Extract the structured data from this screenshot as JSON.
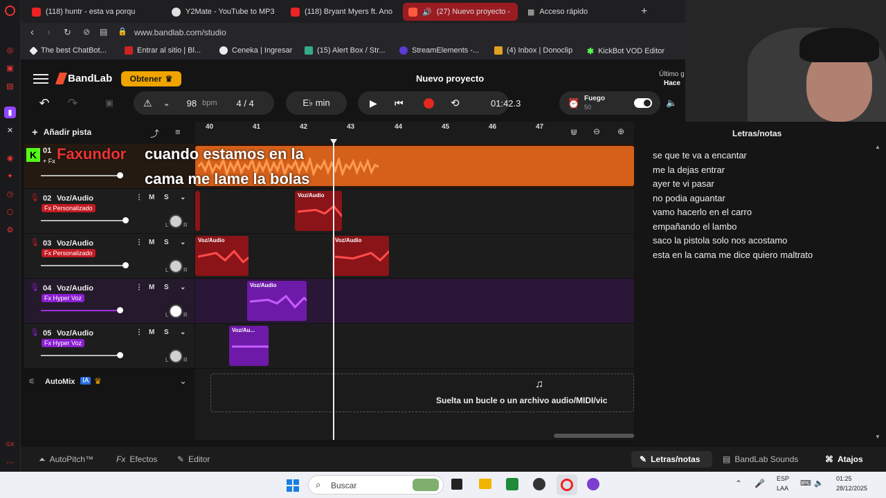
{
  "browser": {
    "tabs": [
      {
        "label": "(118) huntr - esta va porqu",
        "active": false
      },
      {
        "label": "Y2Mate - YouTube to MP3",
        "active": false
      },
      {
        "label": "(118) Bryant Myers ft. Ano",
        "active": false
      },
      {
        "label": "(27) Nuevo proyecto -",
        "active": true
      },
      {
        "label": "Acceso rápido",
        "active": false
      }
    ],
    "url": "www.bandlab.com/studio",
    "bookmarks": [
      "The best ChatBot...",
      "Entrar al sitio | Bl...",
      "Ceneka | Ingresar",
      "(15) Alert Box / Str...",
      "StreamElements -...",
      "(4) Inbox | Donoclip",
      "KickBot VOD Editor"
    ]
  },
  "app": {
    "brand": "BandLab",
    "get_button": "Obtener",
    "project_title": "Nuevo proyecto",
    "save_status": "Último g",
    "save_status2": "Hace",
    "bpm_value": "98",
    "bpm_unit": "bpm",
    "time_signature": "4 / 4",
    "key": "E♭ min",
    "time_display": "01:42.3",
    "fuego_label": "Fuego",
    "fuego_value": "50",
    "add_track": "Añadir pista",
    "ruler": [
      "40",
      "41",
      "42",
      "43",
      "44",
      "45",
      "46",
      "47"
    ],
    "overlay_name": "Faxundor",
    "overlay_text_line1": "cuando estamos en la",
    "overlay_text_line2": "cama me lame la bolas",
    "tracks": [
      {
        "num": "01",
        "name": "",
        "fx": "+ Fx"
      },
      {
        "num": "02",
        "name": "Voz/Audio",
        "fx": "Fx Personalizado"
      },
      {
        "num": "03",
        "name": "Voz/Audio",
        "fx": "Fx Personalizado"
      },
      {
        "num": "04",
        "name": "Voz/Audio",
        "fx": "Fx Hyper Voz"
      },
      {
        "num": "05",
        "name": "Voz/Audio",
        "fx": "Fx Hyper Voz"
      }
    ],
    "clip_labels": [
      "Voz/Audio",
      "Voz/Audio",
      "Voz/Audio",
      "Voz/Audio",
      "Voz/Au..."
    ],
    "mute": "M",
    "solo": "S",
    "pan_l": "L",
    "pan_r": "R",
    "automix": "AutoMix",
    "automix_badge": "IA",
    "drop_hint": "Suelta un bucle o un archivo audio/MIDI/vic",
    "notes_title": "Letras/notas",
    "lyrics": [
      "se que te va a encantar",
      "me la dejas  entrar",
      "ayer te vi pasar",
      "no podia aguantar",
      "vamo hacerlo en el carro",
      "empañando el lambo",
      "saco la pistola solo nos acostamo",
      "esta en la  cama me dice quiero maltrato"
    ],
    "bottom": {
      "autopitch": "AutoPitch™",
      "effects": "Efectos",
      "editor": "Editor",
      "notes_tab": "Letras/notas",
      "sounds": "BandLab Sounds",
      "shortcuts": "Atajos"
    }
  },
  "taskbar": {
    "search": "Buscar",
    "lang1": "ESP",
    "lang2": "LAA",
    "time": "01:25",
    "date": "28/12/2025"
  },
  "colors": {
    "accent": "#f0a400",
    "orange": "#f06a1a",
    "red": "#c41a22",
    "purple": "#8a1fd1",
    "record": "#e3281e"
  }
}
